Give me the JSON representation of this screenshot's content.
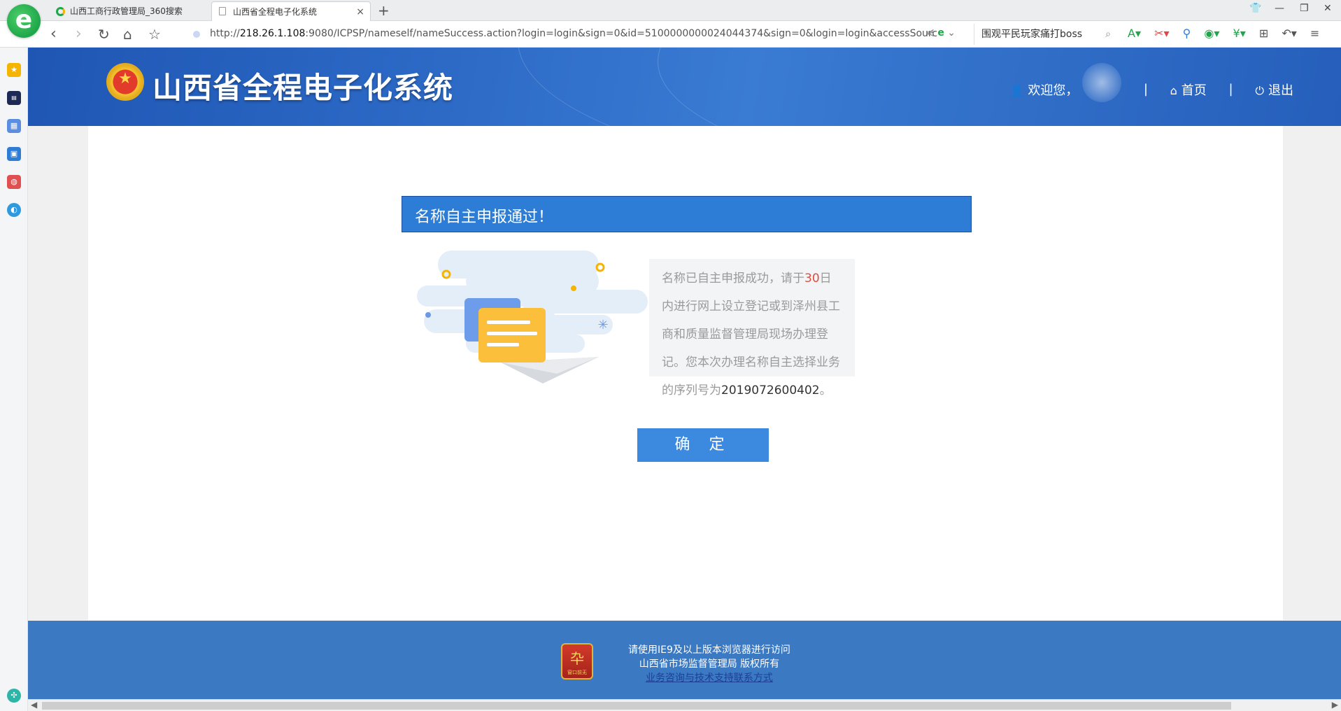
{
  "browser": {
    "logo_letter": "e",
    "tabs": [
      {
        "title": "山西工商行政管理局_360搜索"
      },
      {
        "title": "山西省全程电子化系统",
        "close": "×"
      }
    ],
    "new_tab": "+",
    "url_prefix": "http://",
    "url_host": "218.26.1.108",
    "url_rest": ":9080/ICPSP/nameself/nameSuccess.action?login=login&sign=0&id=5100000000024044374&sign=0&login=login&accessSourceBy",
    "search_text": "围观平民玩家痛打boss"
  },
  "header": {
    "title": "山西省全程电子化系统",
    "welcome": "欢迎您，",
    "home": "首页",
    "logout": "退出",
    "separator": "|"
  },
  "main": {
    "result_title": "名称自主申报通过！",
    "message_part1": "名称已自主申报成功，请于",
    "days": "30",
    "message_part2": "日内进行网上设立登记或到泽州县工商和质量监督管理局现场办理登记。您本次办理名称自主选择业务的序列号为",
    "serial_number": "2019072600402",
    "message_end": "。",
    "confirm_label": "确 定"
  },
  "footer": {
    "badge_text": "窗口前无",
    "line1": "请使用IE9及以上版本浏览器进行访问",
    "line2": "山西省市场监督管理局 版权所有",
    "link": "业务咨询与技术支持联系方式"
  },
  "colors": {
    "header_blue": "#2e6cc8",
    "result_bar": "#2d7dd6",
    "confirm_button": "#3c8ae0",
    "footer_blue": "#3b79c3",
    "highlight_red": "#e34b3c"
  }
}
